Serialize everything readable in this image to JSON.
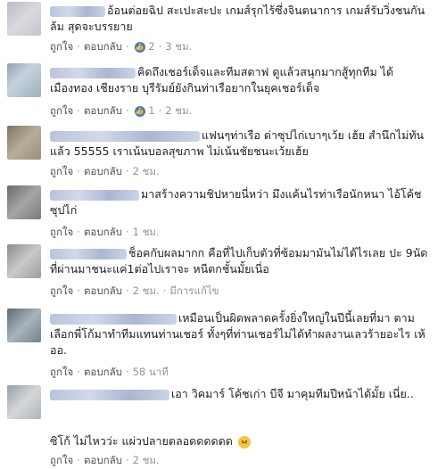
{
  "comments": [
    {
      "text": "อ้อนต่อยฉิป สะเปะสะปะ เกมส์รุกไร้ซึ่งจินตนาการ เกมส์รับวิ่งชนกันล้ม สุดจะบรรยาย",
      "like": "ถูกใจ",
      "reply": "ตอบกลับ",
      "likes_count": "2",
      "time": "3 ชม."
    },
    {
      "text": "คิดถึงเชอร์เด็จและทีมสตาฟ ดูแล้วสนุกมากสู้ทุกทีม ได้ เมืองทอง เชียงราย บุรีรัมย์ยังกินท่าเรือยากในยุคเชอร์เด็จ",
      "like": "ถูกใจ",
      "reply": "ตอบกลับ",
      "likes_count": "1",
      "time": "2 ชม."
    },
    {
      "text": "แฟนๆท่าเรือ ด่าซุปไก่เบาๆเว้ย เฮ้ย สำนึกไม่ทันแล้ว 55555 เราเน้นบอลสุขภาพ ไม่เน้นชัยชนะเว้ยเฮ้ย",
      "like": "ถูกใจ",
      "reply": "ตอบกลับ",
      "time": "2 ชม."
    },
    {
      "text": "มาสร้างความชิปหายนี่หว่า มึงแค้นไรท่าเรือนักหนา ไอ้โค้ชซุปไก่",
      "like": "ถูกใจ",
      "reply": "ตอบกลับ",
      "time": "1 ชม."
    },
    {
      "text": "ช็อคกับผลมากก คือที่ไปเก็บตัวที่ซ้อมมามันไม่ได้ไรเลย ปะ 9นัดที่ผ่านมาชนะแค่1ต่อไปเราจะ หนีตกชั้นมั้ยเนี่อ",
      "like": "ถูกใจ",
      "reply": "ตอบกลับ",
      "time": "2 ชม.",
      "edited": "มีการแก้ไข"
    },
    {
      "text": "เหมือนเป็นผิดพลาดครั้งยิ่งใหญ่ในปีนี้เลยที่มา ตามเลือกพี่โก้มาทำทีมแทนท่านเชอร์ ทั้งๆที่ท่านเชอร์ไม่ได้ทำผลงานเลวร้ายอะไร เห้ออ.",
      "like": "ถูกใจ",
      "reply": "ตอบกลับ",
      "time": "58 นาที"
    },
    {
      "text": "เอา วิคมาร์ โค้ชเก่า บีจี มาคุมทีมปีหน้าได้มั้ย เนี่ย..",
      "text2": "ซิโก้ ไม่ไหวว่ะ แผ่วปลายตลอดดดดดด",
      "like": "ถูกใจ",
      "reply": "ตอบกลับ",
      "time": "2 ชม."
    }
  ]
}
